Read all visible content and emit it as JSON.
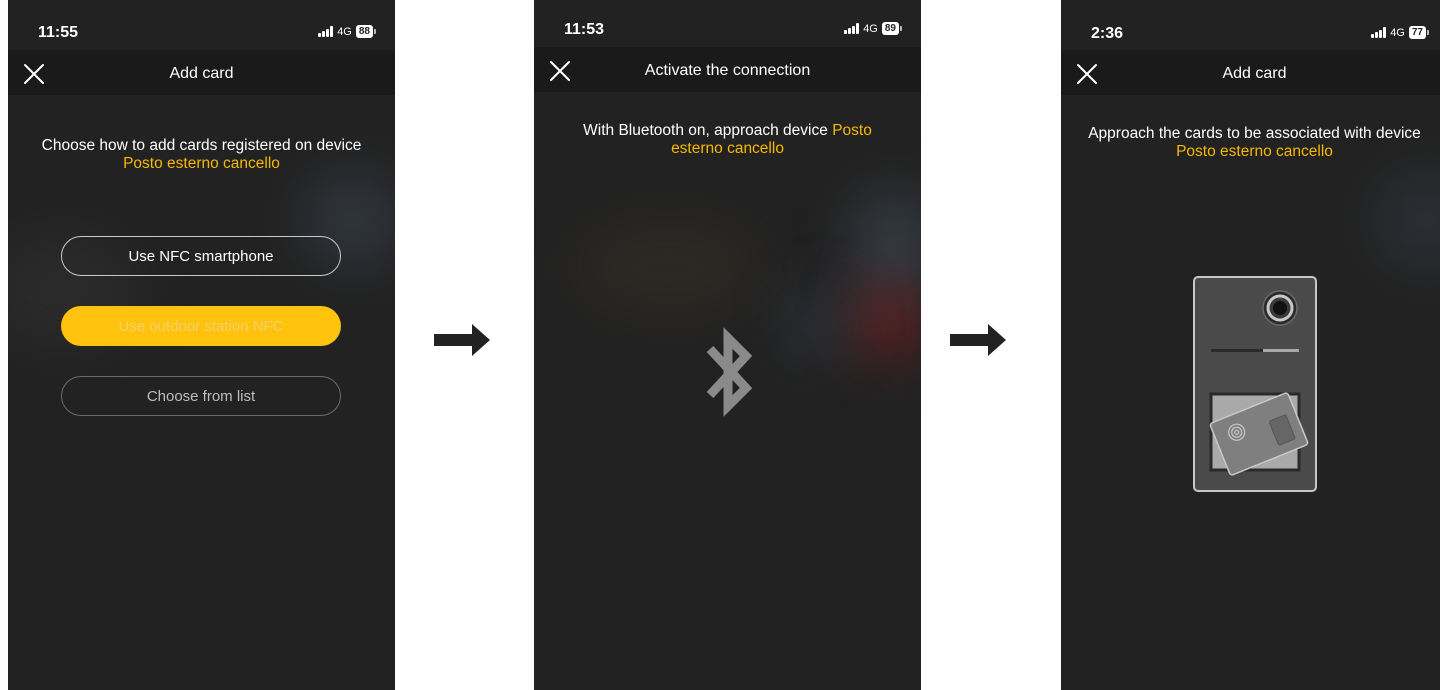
{
  "screens": [
    {
      "status": {
        "time": "11:55",
        "network": "4G",
        "battery": "88"
      },
      "nav": {
        "title": "Add card"
      },
      "message": "Choose how to add cards registered on device",
      "device_name": "Posto esterno cancello",
      "buttons": [
        {
          "label": "Use NFC smartphone"
        },
        {
          "label": "Use outdoor station NFC"
        },
        {
          "label": "Choose from list"
        }
      ]
    },
    {
      "status": {
        "time": "11:53",
        "network": "4G",
        "battery": "89"
      },
      "nav": {
        "title": "Activate the connection"
      },
      "message_line1": "With Bluetooth on, approach device",
      "device_name_part1": "Posto",
      "device_name_part2": "esterno cancello",
      "icon": "bluetooth-icon"
    },
    {
      "status": {
        "time": "2:36",
        "network": "4G",
        "battery": "77"
      },
      "nav": {
        "title": "Add card"
      },
      "message": "Approach the cards to be associated with device",
      "device_name": "Posto esterno cancello",
      "illustration": "outdoor-station-card-illustration"
    }
  ],
  "colors": {
    "accent": "#f6b800",
    "button_yellow": "#ffc20d",
    "background": "#222222"
  }
}
